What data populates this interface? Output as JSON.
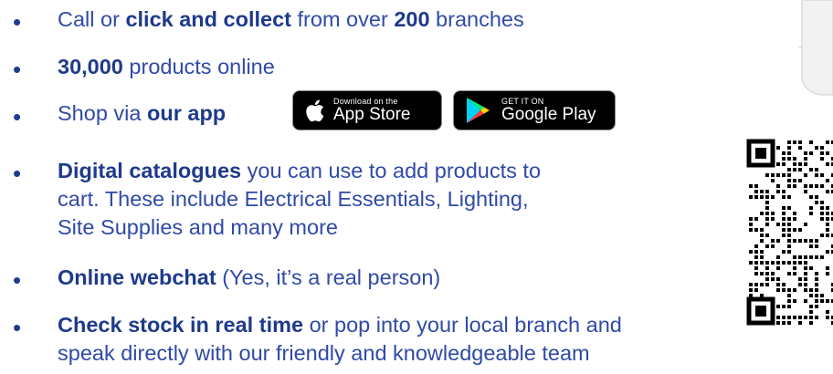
{
  "items": [
    {
      "parts": [
        [
          "Call or ",
          false
        ],
        [
          "click and collect",
          true
        ],
        [
          " from over ",
          false
        ],
        [
          "200",
          true
        ],
        [
          " branches",
          false
        ]
      ]
    },
    {
      "parts": [
        [
          "30,000",
          true
        ],
        [
          " products online",
          false
        ]
      ]
    },
    {
      "parts": [
        [
          "Shop via ",
          false
        ],
        [
          "our app",
          true
        ]
      ]
    },
    {
      "lines": [
        [
          [
            "Digital catalogues",
            true
          ],
          [
            " you can use to add products to",
            false
          ]
        ],
        [
          [
            "cart. These include Electrical Essentials, Lighting,",
            false
          ]
        ],
        [
          [
            "Site Supplies and many more",
            false
          ]
        ]
      ]
    },
    {
      "parts": [
        [
          "Online webchat",
          true
        ],
        [
          " (Yes, it’s a real person)",
          false
        ]
      ]
    },
    {
      "lines": [
        [
          [
            "Check stock in real time",
            true
          ],
          [
            " or pop into your local branch and",
            false
          ]
        ],
        [
          [
            "speak directly with our friendly and knowledgeable team",
            false
          ]
        ]
      ]
    }
  ],
  "bullet_char": "•",
  "app_store": {
    "small": "Download on the",
    "big": "App Store"
  },
  "google_play": {
    "small": "GET IT ON",
    "big": "Google Play"
  },
  "colors": {
    "text": "#2f4aa6",
    "bold": "#1e3a8a",
    "badge_bg": "#000000"
  }
}
